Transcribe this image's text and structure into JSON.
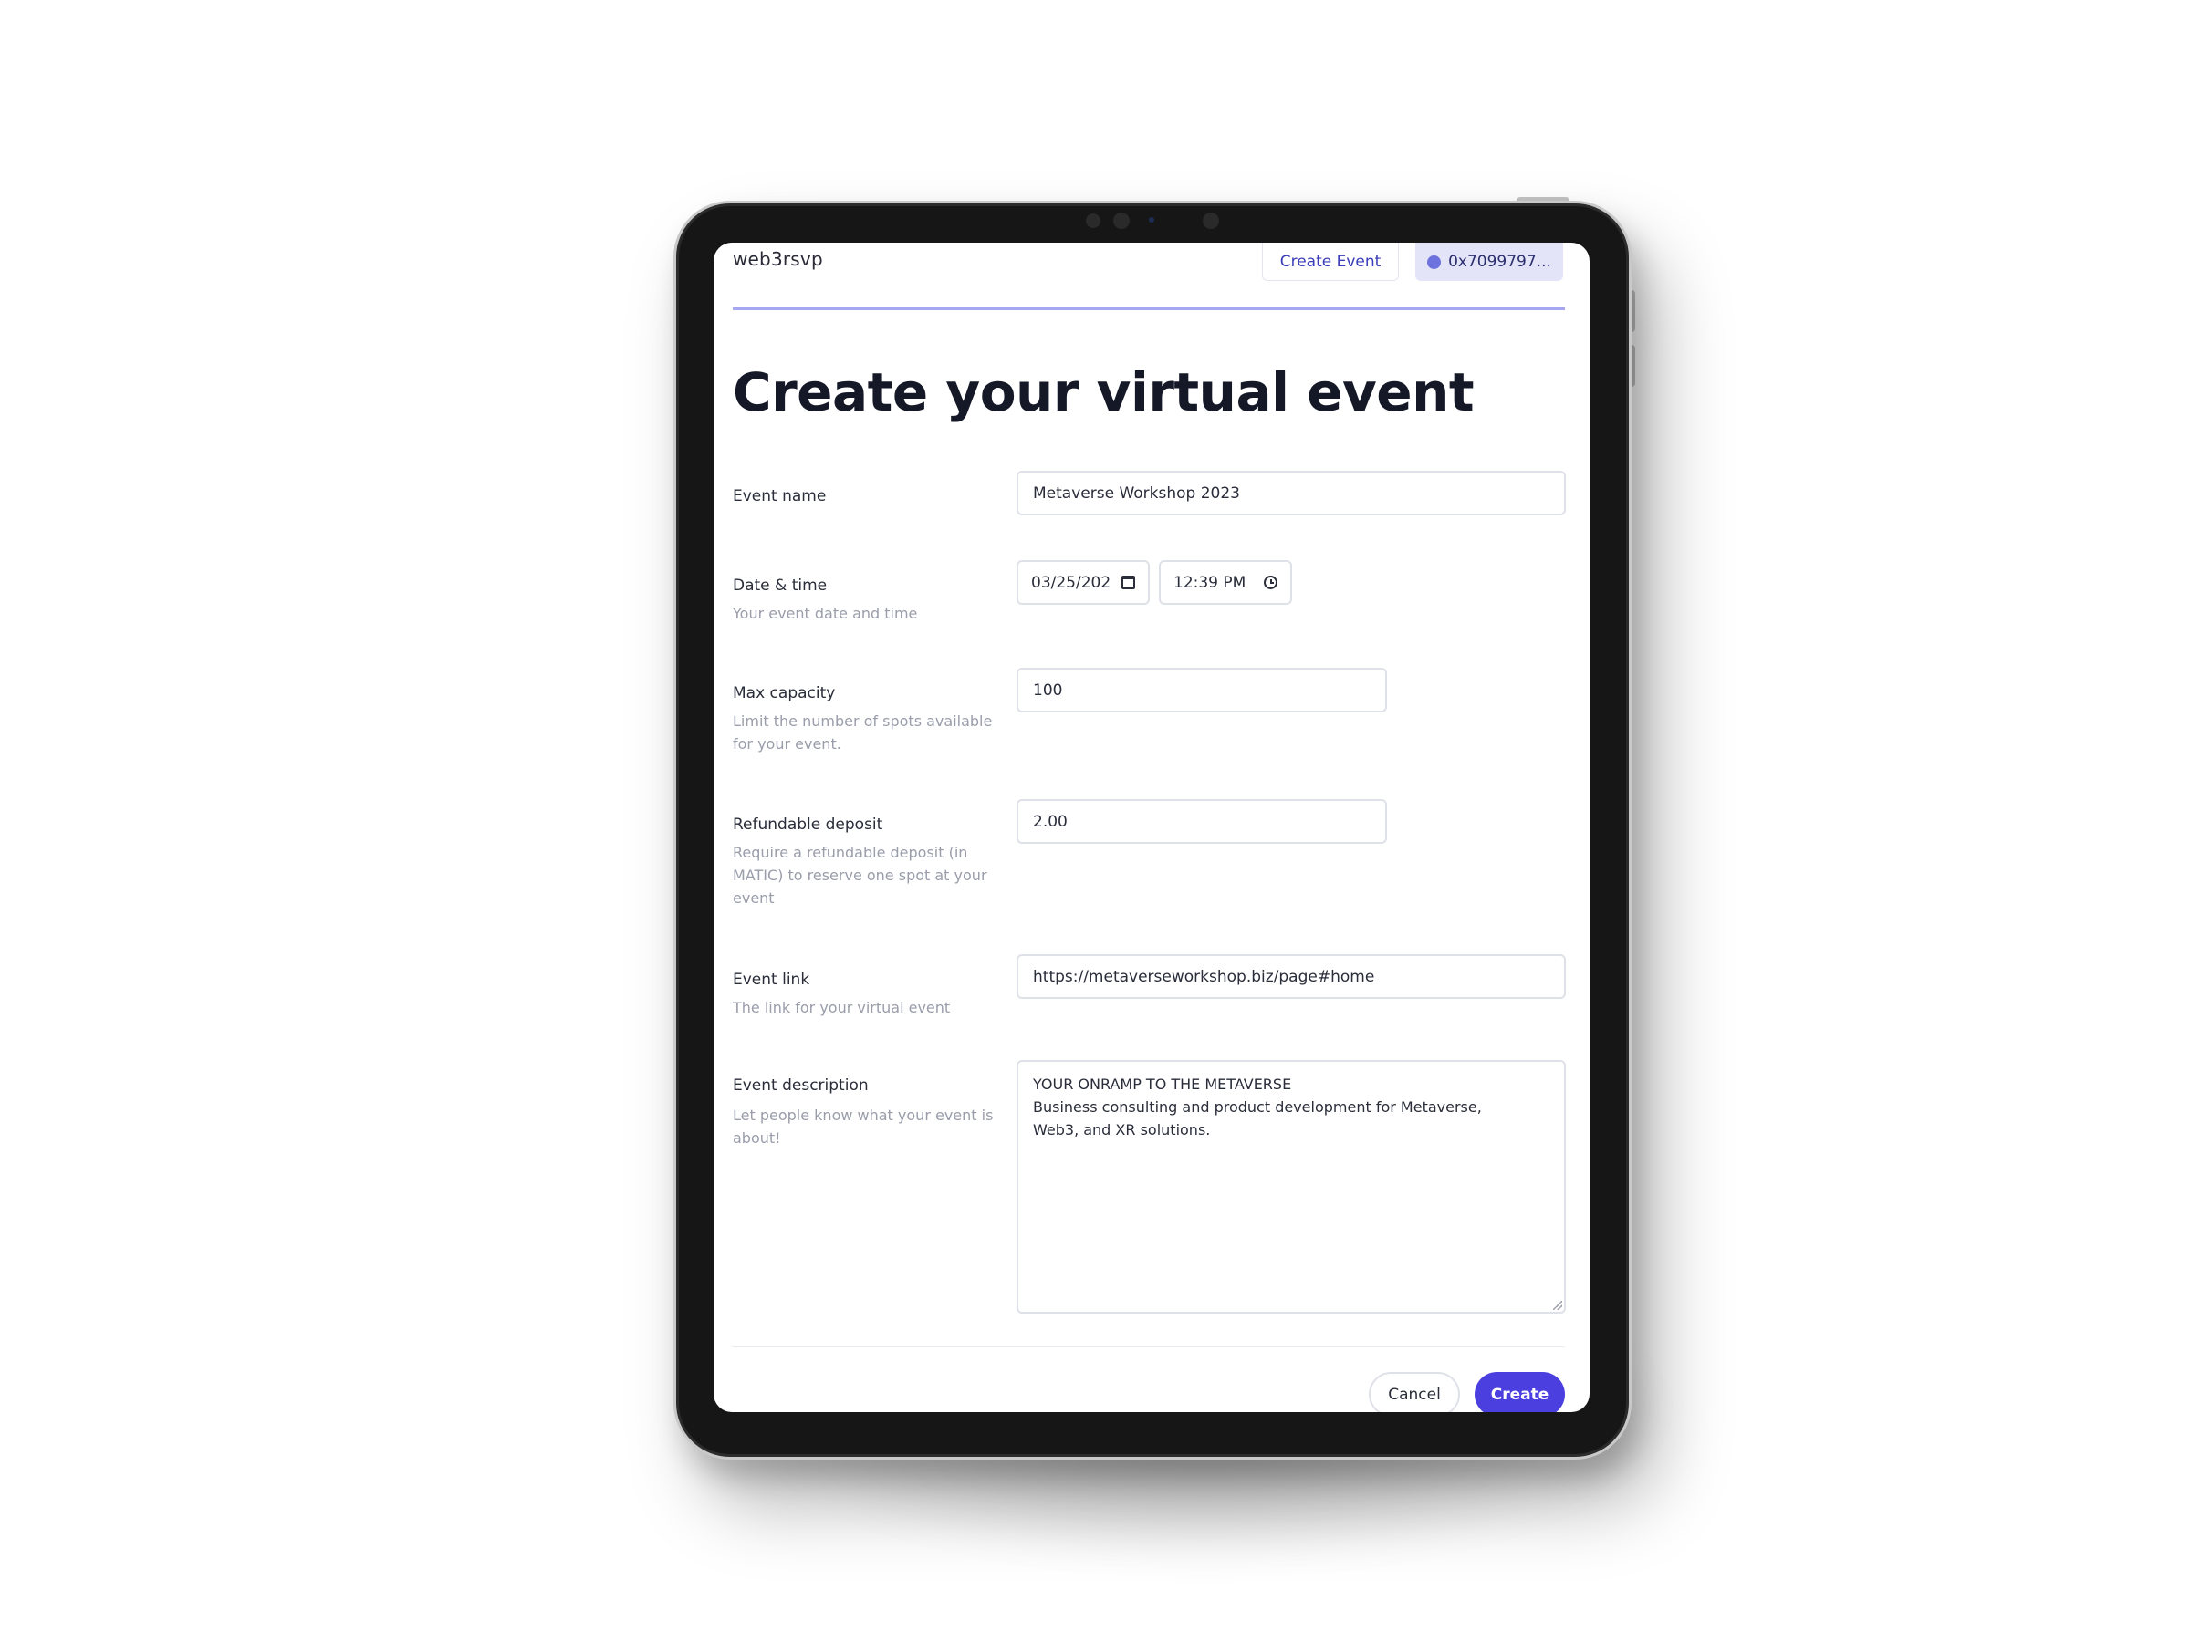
{
  "header": {
    "logo": "web3rsvp",
    "create_event_label": "Create Event",
    "wallet_label": "0x7099797..."
  },
  "page": {
    "title": "Create your virtual event"
  },
  "form": {
    "event_name": {
      "label": "Event name",
      "value": "Metaverse Workshop 2023"
    },
    "date_time": {
      "label": "Date & time",
      "helper": "Your event date and time",
      "date_value": "03/25/202",
      "time_value": "12:39 PM"
    },
    "max_capacity": {
      "label": "Max capacity",
      "helper": "Limit the number of spots available for your event.",
      "value": "100"
    },
    "refundable_deposit": {
      "label": "Refundable deposit",
      "helper": "Require a refundable deposit (in MATIC) to reserve one spot at your event",
      "value": "2.00"
    },
    "event_link": {
      "label": "Event link",
      "helper": "The link for your virtual event",
      "value": "https://metaverseworkshop.biz/page#home"
    },
    "event_description": {
      "label": "Event description",
      "helper": "Let people know what your event is about!",
      "lines": [
        "YOUR ONRAMP TO THE METAVERSE",
        "Business consulting and product development for Metaverse,",
        "Web3, and XR solutions."
      ]
    }
  },
  "actions": {
    "cancel_label": "Cancel",
    "create_label": "Create"
  },
  "colors": {
    "accent": "#4b3fe0",
    "header_underline": "#a5a8f0",
    "wallet_bg": "#e3e4f7"
  }
}
